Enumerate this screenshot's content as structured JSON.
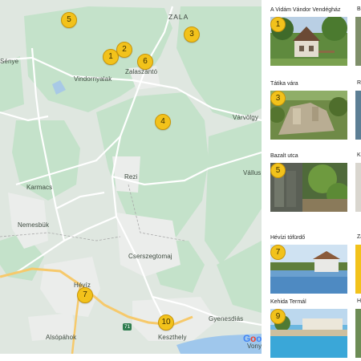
{
  "map": {
    "region_label": "ZALA",
    "places": [
      {
        "name": "Sénye"
      },
      {
        "name": "Vindornyalak"
      },
      {
        "name": "Zalaszántó"
      },
      {
        "name": "Várvölgy"
      },
      {
        "name": "Rezi"
      },
      {
        "name": "Vállus"
      },
      {
        "name": "Karmacs"
      },
      {
        "name": "Nemesbük"
      },
      {
        "name": "Cserszegtomaj"
      },
      {
        "name": "Hévíz"
      },
      {
        "name": "Gyenesdiás"
      },
      {
        "name": "Alsópáhok"
      },
      {
        "name": "Keszthely"
      },
      {
        "name": "Vonyar"
      }
    ],
    "markers": [
      "5",
      "1",
      "2",
      "6",
      "3",
      "4",
      "7",
      "10"
    ],
    "road_shield": "71",
    "google_letters": [
      "G",
      "o",
      "o"
    ]
  },
  "colors": {
    "forest": "#c4e2ca",
    "land": "#dfe7e0",
    "urban": "#e9ebe9",
    "road": "#ffffff",
    "highway": "#f6c96b",
    "water": "#9fc7ec",
    "marker": "#f2c21b"
  },
  "listings": [
    {
      "number": "1",
      "title": "A Vidám Vándor Vendégház"
    },
    {
      "number": "3",
      "title": "Tátika vára"
    },
    {
      "number": "5",
      "title": "Bazalt utca"
    },
    {
      "number": "7",
      "title": "Hévízi tófürdő"
    },
    {
      "number": "9",
      "title": "Kehida Termál"
    }
  ],
  "edge_titles": [
    "Bo",
    "Ra",
    "Ke",
    "Za",
    "H"
  ]
}
